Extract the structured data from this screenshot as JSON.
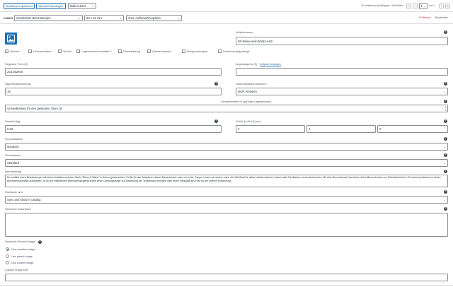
{
  "toolbar": {
    "save_label": "Variationen speichern",
    "add_manual_label": "Manuell hinzufügen",
    "bulk_select": "Bulk actions",
    "count_text": "15 Variationen (Aufklappen / Schließen)",
    "page_value": "1",
    "page_of": "von 2"
  },
  "variation": {
    "id": "#16519",
    "attr_motiv": "elektrischer Brennstempel",
    "attr_size": "50 x 52 mm",
    "attr_box": "ohne Aufbewahrungsbox",
    "remove_label": "Entfernen",
    "edit_label": "Bearbeiten"
  },
  "sku": {
    "label": "Artikelnummer",
    "value": "BS-Biene-elek-50x52-oAB"
  },
  "checks": [
    {
      "label": "Aktiviert",
      "checked": true
    },
    {
      "label": "Herunterladbar",
      "checked": false
    },
    {
      "label": "Virtuell",
      "checked": false
    },
    {
      "label": "Lagerbestand verwalten?",
      "checked": true
    },
    {
      "label": "Dienstleistung",
      "checked": false
    },
    {
      "label": "Gebrauchsware",
      "checked": false
    },
    {
      "label": "Mengenexemplar",
      "checked": false
    },
    {
      "label": "Preisvorschlag-ablage",
      "checked": false
    }
  ],
  "price": {
    "regular_label": "Regulärer Preis (€)",
    "regular_value": "203.352940",
    "sale_label": "Angebotspreis (€)",
    "sale_link": "Zeitplan festlegen",
    "sale_value": ""
  },
  "stock": {
    "qty_label": "Lagerbestandsmenge",
    "qty_value": "18",
    "backorder_label": "Lieferrückstand erlauben?",
    "backorder_value": "Nicht erlauben",
    "threshold_label": "Schwellenwert für „geringer Lagerbestand\"",
    "threshold_value": "Schwellenwert für den gesamten Store (2)"
  },
  "weight": {
    "label": "Gewicht (kg)",
    "value": "0.32",
    "dims_label": "Größe (L×B×H) (cm)",
    "dim_l": "0",
    "dim_b": "0",
    "dim_h": "0"
  },
  "shipping": {
    "label": "Versandklasse",
    "value": "standard"
  },
  "tax": {
    "label": "Steuerklasse",
    "value": "Standard"
  },
  "description": {
    "label": "Beschreibung",
    "value": "Du erhältst einen Brandstempel mit deinen Initialen und dem Motiv \"Biene & Wabe\" in deiner gewünschten Größe für das Markieren deiner Bienenbeuten oder von Holz, Pappe, Leder und vielem mehr. Als Schriftstil für deine Initialen können nahezu alle Schriftarten verwendet werden. Mit dem Brennstempel kannst du deine Bienenbeuten vor Diebstahl sichern. Du kannst passend zu deiner Brennstempelplatte auswählen, ob du ein elektrisches Brennstempelgerät sowie einen Leistungsregler zur Einstellung der Temperatur möchtest oder einen Handgriff aus Holz für die externe Erwärmung."
  },
  "facebook": {
    "sync_label": "Facebook sync",
    "sync_value": "Sync and show in catalog",
    "desc_label": "Facebook Description",
    "image_label": "Facebook Product Image",
    "image_options": [
      "Use variation image",
      "Use parent image",
      "Use custom image"
    ],
    "image_selected": 0,
    "custom_url_label": "Custom Image URL"
  },
  "icons": {
    "help": "help-circle-icon",
    "chevron": "chevron-down-icon",
    "image": "image-placeholder-icon"
  },
  "colors": {
    "accent": "#2271b1",
    "danger": "#d63638",
    "border": "#8c8f94"
  }
}
